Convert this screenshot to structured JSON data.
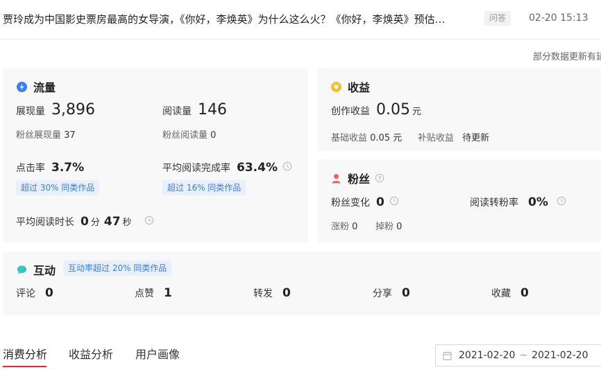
{
  "header": {
    "title": "贾玲成为中国影史票房最高的女导演，《你好，李焕英》为什么这么火？《你好，李焕英》预估…",
    "tag": "问答",
    "time": "02-20 15:13"
  },
  "notice": "部分数据更新有延",
  "traffic": {
    "title": "流量",
    "impressions_label": "展现量",
    "impressions_value": "3,896",
    "fan_impressions_label": "粉丝展现量",
    "fan_impressions_value": "37",
    "reads_label": "阅读量",
    "reads_value": "146",
    "fan_reads_label": "粉丝阅读量",
    "fan_reads_value": "0",
    "ctr_label": "点击率",
    "ctr_value": "3.7%",
    "ctr_badge": "超过 30% 同类作品",
    "completion_label": "平均阅读完成率",
    "completion_value": "63.4%",
    "completion_badge": "超过 16% 同类作品",
    "duration_label": "平均阅读时长",
    "duration_min": "0",
    "duration_min_unit": "分",
    "duration_sec": "47",
    "duration_sec_unit": "秒"
  },
  "income": {
    "title": "收益",
    "creation_label": "创作收益",
    "creation_value": "0.05",
    "creation_unit": "元",
    "base_label": "基础收益",
    "base_value": "0.05 元",
    "subsidy_label": "补贴收益",
    "subsidy_value": "待更新"
  },
  "fans": {
    "title": "粉丝",
    "change_label": "粉丝变化",
    "change_value": "0",
    "conversion_label": "阅读转粉率",
    "conversion_value": "0%",
    "gain_label": "涨粉",
    "gain_value": "0",
    "loss_label": "掉粉",
    "loss_value": "0"
  },
  "interaction": {
    "title": "互动",
    "badge": "互动率超过 20% 同类作品",
    "items": [
      {
        "label": "评论",
        "value": "0"
      },
      {
        "label": "点赞",
        "value": "1"
      },
      {
        "label": "转发",
        "value": "0"
      },
      {
        "label": "分享",
        "value": "0"
      },
      {
        "label": "收藏",
        "value": "0"
      }
    ]
  },
  "tabs": [
    {
      "label": "消费分析"
    },
    {
      "label": "收益分析"
    },
    {
      "label": "用户画像"
    }
  ],
  "date_range": {
    "start": "2021-02-20",
    "separator": "~",
    "end": "2021-02-20"
  },
  "colors": {
    "traffic_icon": "#3d7cf4",
    "income_icon": "#f5c02a",
    "fans_icon": "#f06464",
    "interaction_icon": "#35c5c5",
    "badge_text": "#3a7ddf",
    "active_tab": "#e0263d"
  }
}
